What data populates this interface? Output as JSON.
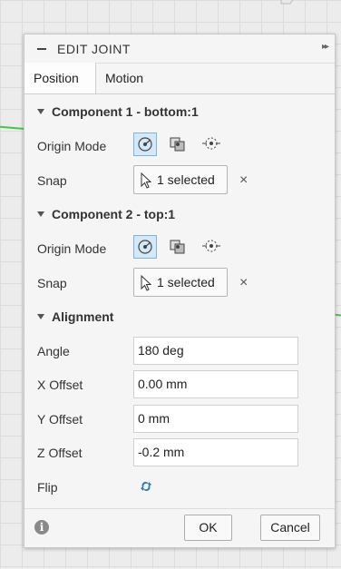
{
  "dialog": {
    "title": "EDIT JOINT",
    "tabs": [
      {
        "label": "Position"
      },
      {
        "label": "Motion"
      }
    ]
  },
  "component1": {
    "header": "Component 1 - bottom:1",
    "origin_mode_label": "Origin Mode",
    "snap_label": "Snap",
    "snap_value": "1 selected",
    "clear_symbol": "×"
  },
  "component2": {
    "header": "Component 2 - top:1",
    "origin_mode_label": "Origin Mode",
    "snap_label": "Snap",
    "snap_value": "1 selected",
    "clear_symbol": "×"
  },
  "alignment": {
    "header": "Alignment",
    "angle_label": "Angle",
    "angle_value": "180 deg",
    "x_offset_label": "X Offset",
    "x_offset_value": "0.00 mm",
    "y_offset_label": "Y Offset",
    "y_offset_value": "0 mm",
    "z_offset_label": "Z Offset",
    "z_offset_value": "-0.2 mm",
    "flip_label": "Flip"
  },
  "footer": {
    "info_symbol": "i",
    "ok_label": "OK",
    "cancel_label": "Cancel"
  },
  "icons": {
    "origin_modes": [
      "simple-origin-icon",
      "between-two-faces-icon",
      "two-edge-intersection-icon"
    ],
    "selected_mode_index": 0
  },
  "colors": {
    "selected_mode_bg": "#d5e8f7",
    "selected_mode_border": "#7fb3db",
    "flip_icon": "#2a7ab8",
    "axis_green": "#49c24e"
  }
}
